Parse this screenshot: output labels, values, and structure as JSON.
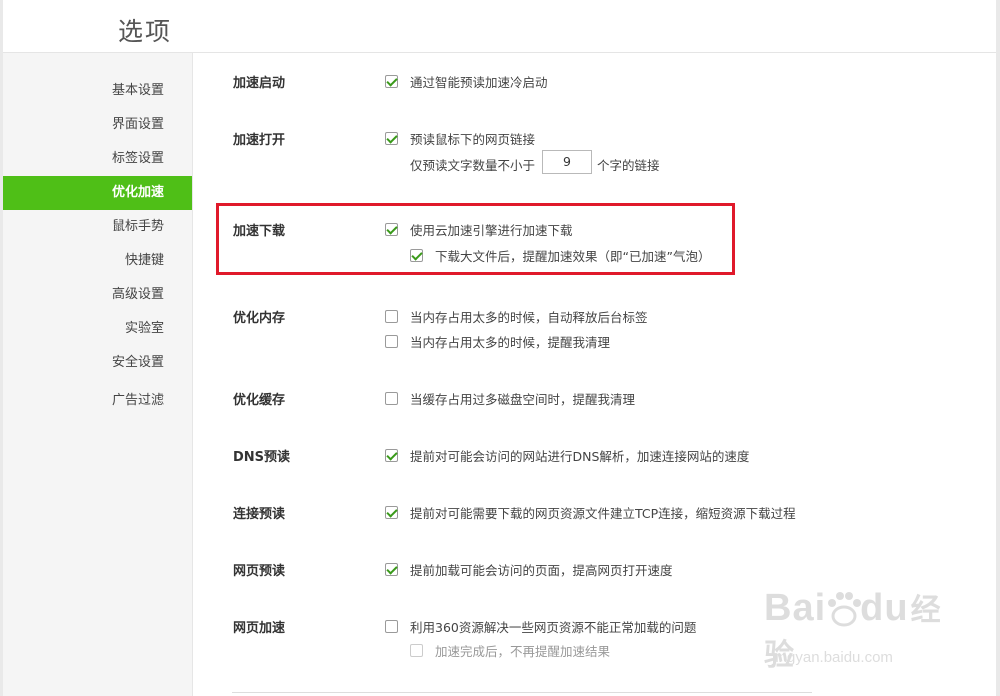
{
  "window": {
    "title": "选项"
  },
  "sidebar": {
    "items": [
      {
        "label": "基本设置",
        "active": false
      },
      {
        "label": "界面设置",
        "active": false
      },
      {
        "label": "标签设置",
        "active": false
      },
      {
        "label": "优化加速",
        "active": true
      },
      {
        "label": "鼠标手势",
        "active": false
      },
      {
        "label": "快捷键",
        "active": false
      },
      {
        "label": "高级设置",
        "active": false
      },
      {
        "label": "实验室",
        "active": false
      },
      {
        "label": "安全设置",
        "active": false
      },
      {
        "label": "广告过滤",
        "active": false
      }
    ]
  },
  "sections": {
    "accel_start": {
      "label": "加速启动",
      "options": [
        {
          "text": "通过智能预读加速冷启动",
          "checked": true
        }
      ]
    },
    "accel_open": {
      "label": "加速打开",
      "options": [
        {
          "text": "预读鼠标下的网页链接",
          "checked": true
        }
      ],
      "min_chars_prefix": "仅预读文字数量不小于",
      "min_chars_value": "9",
      "min_chars_suffix": "个字的链接"
    },
    "accel_download": {
      "label": "加速下载",
      "options": [
        {
          "text": "使用云加速引擎进行加速下载",
          "checked": true
        },
        {
          "text": "下载大文件后，提醒加速效果（即“已加速”气泡）",
          "checked": true
        }
      ]
    },
    "opt_memory": {
      "label": "优化内存",
      "options": [
        {
          "text": "当内存占用太多的时候，自动释放后台标签",
          "checked": false
        },
        {
          "text": "当内存占用太多的时候，提醒我清理",
          "checked": false
        }
      ]
    },
    "opt_cache": {
      "label": "优化缓存",
      "options": [
        {
          "text": "当缓存占用过多磁盘空间时，提醒我清理",
          "checked": false
        }
      ]
    },
    "dns_prefetch": {
      "label": "DNS预读",
      "options": [
        {
          "text": "提前对可能会访问的网站进行DNS解析，加速连接网站的速度",
          "checked": true
        }
      ]
    },
    "conn_prefetch": {
      "label": "连接预读",
      "options": [
        {
          "text": "提前对可能需要下载的网页资源文件建立TCP连接，缩短资源下载过程",
          "checked": true
        }
      ]
    },
    "page_prefetch": {
      "label": "网页预读",
      "options": [
        {
          "text": "提前加载可能会访问的页面，提高网页打开速度",
          "checked": true
        }
      ]
    },
    "page_accel": {
      "label": "网页加速",
      "options": [
        {
          "text": "利用360资源解决一些网页资源不能正常加载的问题",
          "checked": false
        },
        {
          "text": "加速完成后，不再提醒加速结果",
          "checked": false,
          "disabled": true
        }
      ]
    }
  },
  "watermark": {
    "brand": "Bai",
    "brand2": "du",
    "brand_cn": "经验",
    "url": "jingyan.baidu.com"
  },
  "colors": {
    "accent": "#4fbf17",
    "highlight": "#e0192a",
    "check": "#3a9a1a"
  }
}
